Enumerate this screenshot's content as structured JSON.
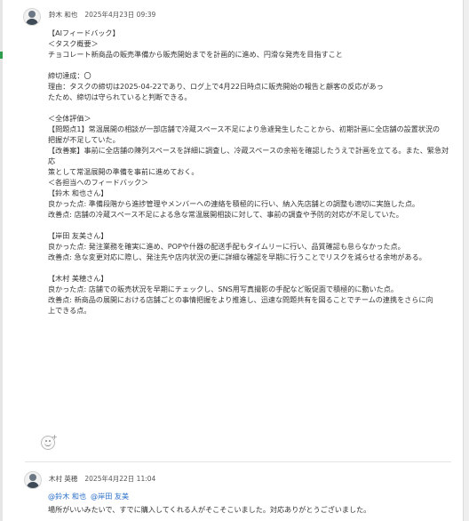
{
  "post1": {
    "author": "鈴木 和也",
    "date": "2025年4月23日 09:39",
    "lines": [
      "【AIフィードバック】",
      "＜タスク概要＞",
      "チョコレート新商品の販売準備から販売開始までを計画的に進め、円滑な発売を目指すこと",
      "",
      "締切達成：〇",
      "理由：タスクの締切は2025-04-22であり、ログ上で4月22日時点に販売開始の報告と顧客の反応があったため、締切は守られていると判断できる。",
      "",
      "＜全体評価＞",
      "【問題点1】常温展開の相談が一部店舗で冷蔵スペース不足により急遽発生したことから、初期計画に全店舗の設置状況の把握が不足していた。",
      "【改善案】事前に全店舗の陳列スペースを詳細に調査し、冷蔵スペースの余裕を確認したうえで計画を立てる。また、緊急対応策として常温展開の準備を事前に進めておく。",
      "",
      "＜各担当へのフィードバック＞",
      "【鈴木 和也さん】",
      "良かった点: 準備段階から進捗管理やメンバーへの連絡を積極的に行い、納入先店舗との調整も適切に実施した点。",
      "改善点: 店舗の冷蔵スペース不足による急な常温展開相談に対して、事前の調査や予防的対応が不足していた。",
      "",
      "【岸田 友美さん】",
      "良かった点: 発注業務を確実に進め、POPや什器の配送手配もタイムリーに行い、品質確認も怠らなかった点。",
      "改善点: 急な変更対応に際し、発注先や店内状況の更に詳細な確認を早期に行うことでリスクを減らせる余地がある。",
      "",
      "【木村 美穂さん】",
      "良かった点: 店舗での販売状況を早期にチェックし、SNS用写真撮影の手配など販促面で積極的に動いた点。",
      "改善点: 新商品の展開における店舗ごとの事情把握をより推進し、迅速な問題共有を図ることでチームの連携をさらに向上できる点。"
    ]
  },
  "post2": {
    "author": "木村 英穂",
    "date": "2025年4月22日 11:04",
    "mentions": [
      "@鈴木 和也",
      "@岸田 友美"
    ],
    "text": "場所がいいみたいで、すでに購入してくれる人がそこそこいました。対応ありがとうございました。"
  },
  "icons": {
    "avatar": "user-avatar-icon",
    "reaction": "add-reaction-icon"
  },
  "colors": {
    "mention": "#2a6fc9",
    "text": "#333333",
    "frame": "#e6e6e6"
  }
}
